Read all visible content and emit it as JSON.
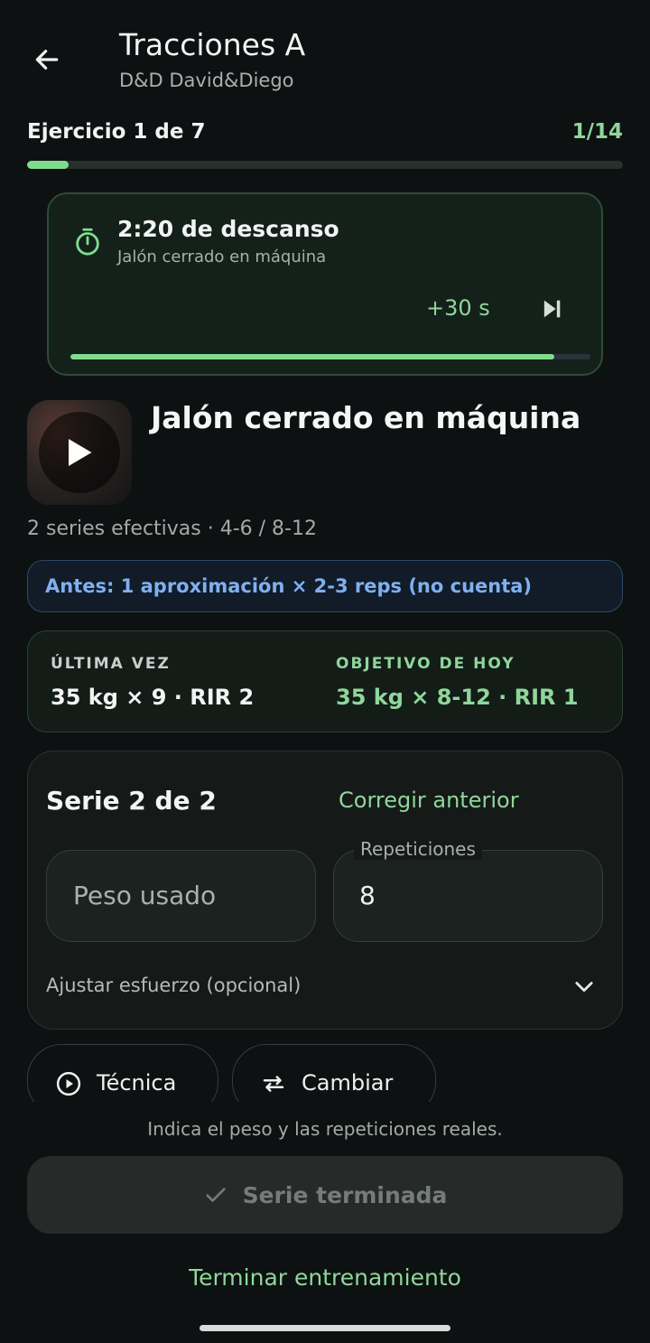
{
  "header": {
    "title": "Tracciones A",
    "subtitle": "D&D David&Diego"
  },
  "progress": {
    "exercise_label": "Ejercicio 1 de 7",
    "set_count": "1/14",
    "fraction": 0.07
  },
  "rest": {
    "title": "2:20 de descanso",
    "exercise": "Jalón cerrado en máquina",
    "add_time": "+30 s",
    "fraction": 0.93
  },
  "exercise": {
    "name": "Jalón cerrado en máquina",
    "meta": "2 series efectivas · 4-6 / 8-12",
    "before_note": "Antes: 1 aproximación × 2-3 reps (no cuenta)"
  },
  "compare": {
    "last_label": "ÚLTIMA VEZ",
    "last_value": "35 kg × 9 · RIR 2",
    "goal_label": "OBJETIVO DE HOY",
    "goal_value": "35 kg × 8-12 · RIR 1"
  },
  "set": {
    "title": "Serie 2 de 2",
    "correct_label": "Corregir anterior",
    "weight_placeholder": "Peso usado",
    "reps_label": "Repeticiones",
    "reps_value": "8",
    "effort_label": "Ajustar esfuerzo (opcional)"
  },
  "actions": {
    "technique": "Técnica",
    "swap": "Cambiar",
    "hint": "Indica el peso y las repeticiones reales.",
    "done": "Serie terminada",
    "finish": "Terminar entrenamiento"
  },
  "colors": {
    "accent": "#8fd69b",
    "info": "#7fb0f0",
    "background": "#0d1111"
  }
}
